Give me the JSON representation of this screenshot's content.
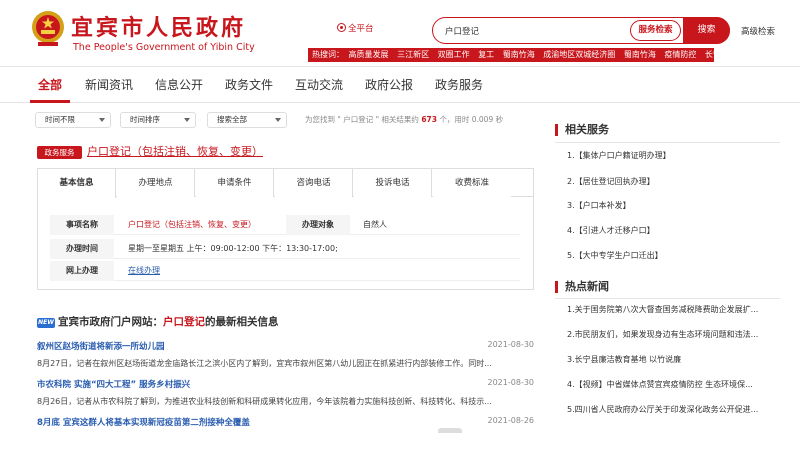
{
  "header": {
    "site_name_cn": "宜宾市人民政府",
    "site_name_en": "The People's Government of Yibin City",
    "scope_label": "全平台",
    "search_value": "户口登记",
    "service_search_label": "服务检索",
    "search_button_label": "搜索",
    "advanced_search_label": "高级检索",
    "hot_label": "热搜词：",
    "hot_words": [
      "高质量发展",
      "三江新区",
      "双圈工作",
      "复工",
      "蜀南竹海",
      "成渝地区双城经济圈",
      "蜀南竹海",
      "疫情防控",
      "长宁"
    ]
  },
  "nav": {
    "tabs": [
      "全部",
      "新闻资讯",
      "信息公开",
      "政务文件",
      "互动交流",
      "政府公报",
      "政务服务"
    ],
    "active_index": 0
  },
  "filters": {
    "time_range": "时间不限",
    "sort": "时间排序",
    "scope": "搜索全部",
    "stat_prefix": "为您找到 \" 户口登记 \" 相关结果约",
    "stat_count": "673",
    "stat_suffix": "个，用时 0.009 秒"
  },
  "service": {
    "tag": "政务服务",
    "title": "户口登记（包括注销、恢复、变更）",
    "tabs": [
      "基本信息",
      "办理地点",
      "申请条件",
      "咨询电话",
      "投诉电话",
      "收费标准"
    ],
    "active_tab": 0,
    "rows": {
      "item_label": "事项名称",
      "item_value": "户口登记（包括注销、恢复、变更）",
      "target_label": "办理对象",
      "target_value": "自然人",
      "time_label": "办理时间",
      "time_value": "星期一至星期五 上午：09:00-12:00 下午：13:30-17:00;",
      "online_label": "网上办理",
      "online_value": "在线办理"
    }
  },
  "news": {
    "badge": "NEW",
    "heading_prefix": "宜宾市政府门户网站：",
    "heading_keyword": "户口登记",
    "heading_suffix": "的最新相关信息",
    "items": [
      {
        "title": "叙州区赵场街道将新添一所幼儿园",
        "date": "2021-08-30",
        "summary": "8月27日，记者在叙州区赵场街道龙金庙路长江之滨小区内了解到，宜宾市叙州区第八幼儿园正在抓紧进行内部装修工作。同时..."
      },
      {
        "title": "市农科院 实施“四大工程” 服务乡村振兴",
        "date": "2021-08-30",
        "summary": "8月26日，记者从市农科院了解到，为推进农业科技创新和科研成果转化应用，今年该院着力实施科技创新、科技转化、科技示..."
      },
      {
        "title": "8月底 宜宾这群人将基本实现新冠疫苗第二剂接种全覆盖",
        "date": "2021-08-26",
        "summary": ""
      }
    ]
  },
  "sidebar": {
    "services_title": "相关服务",
    "services": [
      "1.【集体户口户籍证明办理】",
      "2.【居住登记回执办理】",
      "3.【户口本补发】",
      "4.【引进人才迁移户口】",
      "5.【大中专学生户口迁出】"
    ],
    "news_title": "热点新闻",
    "news": [
      "1.关于国务院第八次大督查国务减税降费助企发展扩...",
      "2.市民朋友们，如果发现身边有生态环境问题和违法...",
      "3.长宁县廉洁教育基地 以竹说廉",
      "4.【视频】中省媒体点赞宜宾疫情防控 生态环境保...",
      "5.四川省人民政府办公厅关于印发深化政务公开促进..."
    ]
  },
  "colors": {
    "accent": "#c8161d",
    "link": "#2a5db0"
  }
}
